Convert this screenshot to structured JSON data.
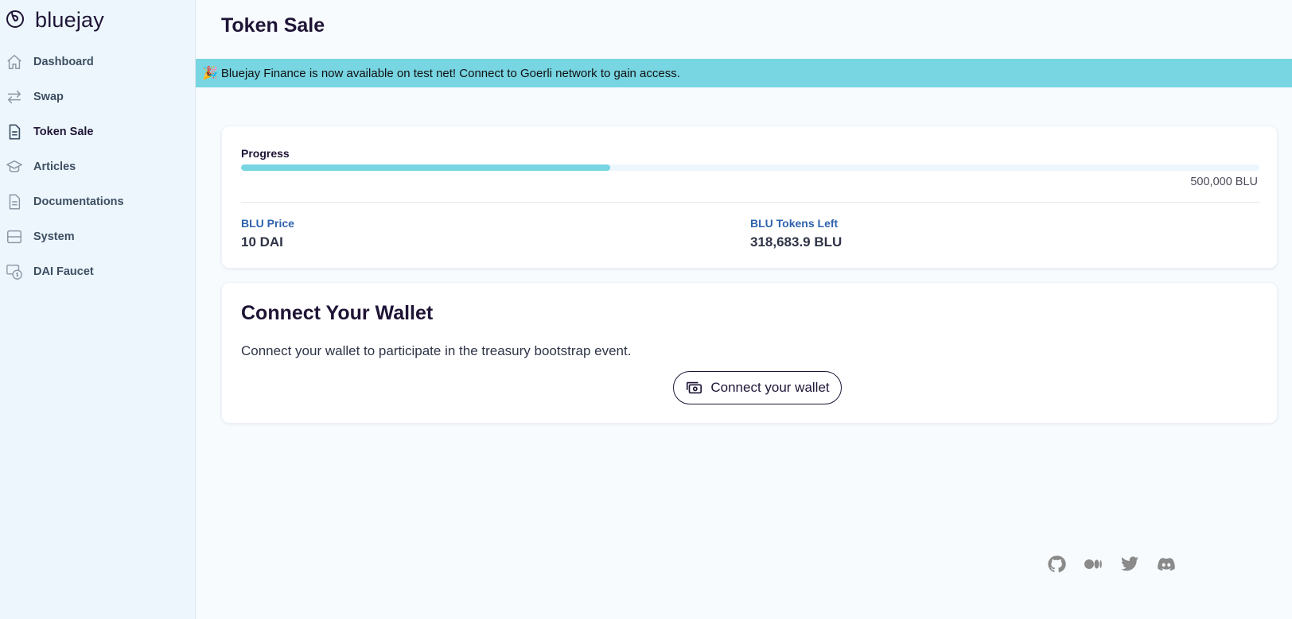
{
  "app": {
    "name": "bluejay"
  },
  "sidebar": {
    "items": [
      {
        "label": "Dashboard",
        "icon": "home-icon"
      },
      {
        "label": "Swap",
        "icon": "swap-arrows-icon"
      },
      {
        "label": "Token Sale",
        "icon": "document-icon",
        "active": true
      },
      {
        "label": "Articles",
        "icon": "academic-cap-icon"
      },
      {
        "label": "Documentations",
        "icon": "document-text-icon"
      },
      {
        "label": "System",
        "icon": "server-icon"
      },
      {
        "label": "DAI Faucet",
        "icon": "cash-icon"
      }
    ]
  },
  "header": {
    "title": "Token Sale"
  },
  "banner": {
    "emoji": "🎉",
    "text": "Bluejay Finance is now available on test net! Connect to Goerli network to gain access."
  },
  "progress": {
    "label": "Progress",
    "fraction": 0.3626,
    "total": "500,000 BLU"
  },
  "stats": {
    "price_label": "BLU Price",
    "price_value": "10 DAI",
    "tokens_left_label": "BLU Tokens Left",
    "tokens_left_value": "318,683.9 BLU"
  },
  "wallet": {
    "title": "Connect Your Wallet",
    "description": "Connect your wallet to participate in the treasury bootstrap event.",
    "button_label": "Connect your wallet"
  },
  "social": [
    "github-icon",
    "medium-icon",
    "twitter-icon",
    "discord-icon"
  ],
  "colors": {
    "accent": "#78d5e2",
    "sidebar_bg": "#edf6fc",
    "stat_label": "#2f63ad",
    "text_dark": "#1f1436"
  }
}
